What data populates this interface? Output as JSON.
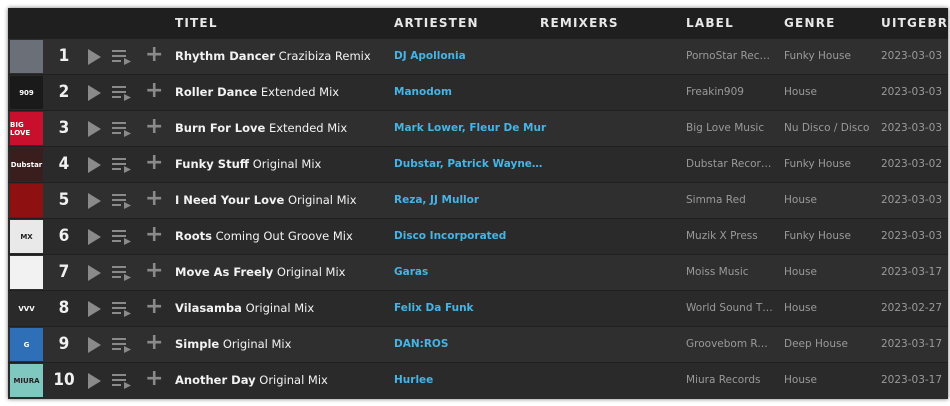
{
  "header": {
    "titel": "TITEL",
    "artiesten": "ARTIESTEN",
    "remixers": "REMIXERS",
    "label": "LABEL",
    "genre": "GENRE",
    "uitgebracht": "UITGEBRACHT"
  },
  "colors": {
    "artist_link": "#45b4e6",
    "row_bg": "#2f2f2f",
    "header_bg": "#1f1f1f"
  },
  "tracks": [
    {
      "num": "1",
      "name": "Rhythm Dancer",
      "mix": "Crazibiza Remix",
      "artists": "DJ Apollonia",
      "label": "PornoStar Rec…",
      "genre": "Funky House",
      "date": "2023-03-03",
      "art_text": "",
      "art_color": "#6a6f78"
    },
    {
      "num": "2",
      "name": "Roller Dance",
      "mix": "Extended Mix",
      "artists": "Manodom",
      "label": "Freakin909",
      "genre": "House",
      "date": "2023-03-03",
      "art_text": "909",
      "art_color": "#1a1a1a"
    },
    {
      "num": "3",
      "name": "Burn For Love",
      "mix": "Extended Mix",
      "artists": "Mark Lower, Fleur De Mur",
      "label": "Big Love Music",
      "genre": "Nu Disco / Disco",
      "date": "2023-03-03",
      "art_text": "BIG LOVE",
      "art_color": "#c8102e"
    },
    {
      "num": "4",
      "name": "Funky Stuff",
      "mix": "Original Mix",
      "artists": "Dubstar, Patrick Wayne…",
      "label": "Dubstar Recor…",
      "genre": "Funky House",
      "date": "2023-03-02",
      "art_text": "Dubstar",
      "art_color": "#3a1d1d"
    },
    {
      "num": "5",
      "name": "I Need Your Love",
      "mix": "Original Mix",
      "artists": "Reza, JJ Mullor",
      "label": "Simma Red",
      "genre": "House",
      "date": "2023-03-03",
      "art_text": "",
      "art_color": "#8e1010"
    },
    {
      "num": "6",
      "name": "Roots",
      "mix": "Coming Out Groove Mix",
      "artists": "Disco Incorporated",
      "label": "Muzik X Press",
      "genre": "Funky House",
      "date": "2023-03-03",
      "art_text": "MX",
      "art_color": "#e9e9e9"
    },
    {
      "num": "7",
      "name": "Move As Freely",
      "mix": "Original Mix",
      "artists": "Garas",
      "label": "Moiss Music",
      "genre": "House",
      "date": "2023-03-17",
      "art_text": "",
      "art_color": "#f2f2f2"
    },
    {
      "num": "8",
      "name": "Vilasamba",
      "mix": "Original Mix",
      "artists": "Felix Da Funk",
      "label": "World Sound T…",
      "genre": "House",
      "date": "2023-02-27",
      "art_text": "VVV",
      "art_color": "#2a2a2a"
    },
    {
      "num": "9",
      "name": "Simple",
      "mix": "Original Mix",
      "artists": "DAN:ROS",
      "label": "Groovebom Re…",
      "genre": "Deep House",
      "date": "2023-03-17",
      "art_text": "G",
      "art_color": "#2f6fb8"
    },
    {
      "num": "10",
      "name": "Another Day",
      "mix": "Original Mix",
      "artists": "Hurlee",
      "label": "Miura Records",
      "genre": "House",
      "date": "2023-03-17",
      "art_text": "MIURA",
      "art_color": "#7fc8c0"
    }
  ]
}
